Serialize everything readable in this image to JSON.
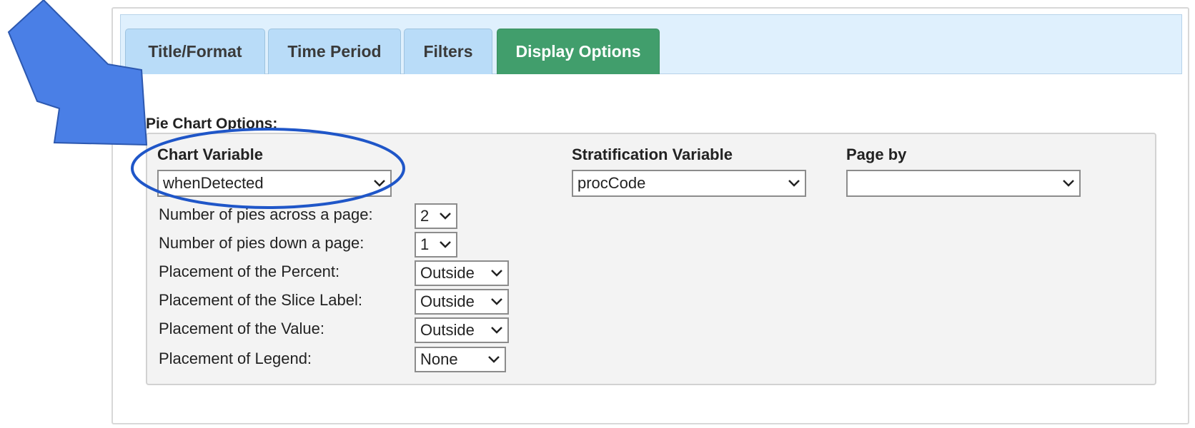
{
  "tabs": [
    {
      "label": "Title/Format",
      "active": false
    },
    {
      "label": "Time Period",
      "active": false
    },
    {
      "label": "Filters",
      "active": false
    },
    {
      "label": "Display Options",
      "active": true
    }
  ],
  "section_title": "Pie Chart Options:",
  "chart_variable": {
    "label": "Chart Variable",
    "value": "whenDetected"
  },
  "stratification_variable": {
    "label": "Stratification Variable",
    "value": "procCode"
  },
  "page_by": {
    "label": "Page by",
    "value": ""
  },
  "options": [
    {
      "label": "Number of pies across a page:",
      "value": "2"
    },
    {
      "label": "Number of pies down a page:",
      "value": "1"
    },
    {
      "label": "Placement of the Percent:",
      "value": "Outside"
    },
    {
      "label": "Placement of the Slice Label:",
      "value": "Outside"
    },
    {
      "label": "Placement of the Value:",
      "value": "Outside"
    },
    {
      "label": "Placement of Legend:",
      "value": "None"
    }
  ],
  "colors": {
    "arrow": "#4a7fe6",
    "circle": "#1f56c8",
    "active_tab": "#419e6c",
    "tab": "#b9dcf8"
  },
  "icons": {
    "dropdown": "chevron-down-icon",
    "annotation_arrow": "arrow-down-right-icon",
    "annotation_circle": "highlight-ellipse"
  }
}
